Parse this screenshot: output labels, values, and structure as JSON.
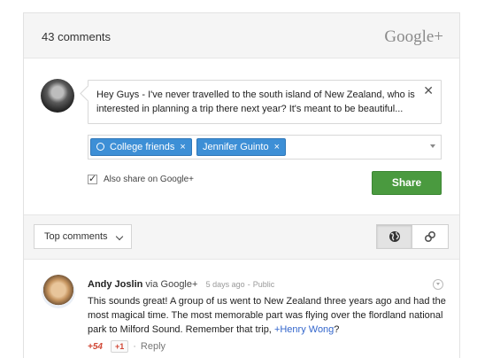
{
  "header": {
    "count": "43 comments",
    "brand": "Google+"
  },
  "composer": {
    "text": "Hey Guys - I've never travelled to the south island of New Zealand, who is interested in planning a trip there next year? It's meant to be beautiful...",
    "close": "✕",
    "chips": [
      {
        "label": "College friends",
        "remove": "×"
      },
      {
        "label": "Jennifer Guinto",
        "remove": "×"
      }
    ],
    "also_share": "Also share on Google+",
    "share_button": "Share"
  },
  "toolbar": {
    "sort_label": "Top comments"
  },
  "comment": {
    "author": "Andy Joslin",
    "via": "via Google+",
    "time": "5 days ago",
    "sep": "-",
    "visibility": "Public",
    "text_before": "This sounds great! A group of us went to New Zealand three years ago and had the most magical time. The most memorable part was flying over the flordland national park to Milford Sound. Remember that trip, ",
    "mention": "+Henry Wong",
    "text_after": "?",
    "plus_count": "+54",
    "plus_one": "+1",
    "dot": "·",
    "reply": "Reply"
  },
  "colors": {
    "accent": "#3d8fd6",
    "share": "#4a9a3f",
    "plus": "#d14836",
    "link": "#3366cc"
  }
}
